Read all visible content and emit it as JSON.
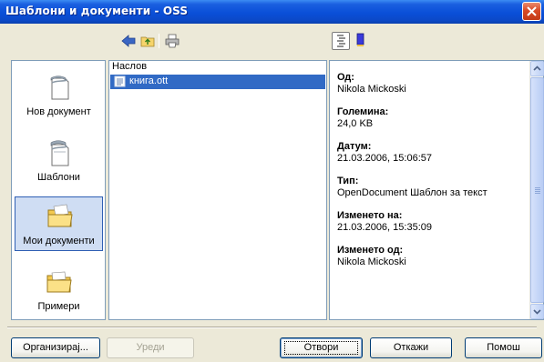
{
  "window": {
    "title": "Шаблони и документи - OSS"
  },
  "toolbar": {
    "back_icon": "back-arrow-icon",
    "up_icon": "folder-up-icon",
    "print_icon": "printer-icon",
    "preview_icon": "document-properties-icon",
    "preview_alt_icon": "document-preview-icon"
  },
  "sidebar": {
    "items": [
      {
        "label": "Нов документ",
        "icon": "new-document-icon",
        "selected": false
      },
      {
        "label": "Шаблони",
        "icon": "templates-icon",
        "selected": false
      },
      {
        "label": "Мои документи",
        "icon": "my-documents-folder-icon",
        "selected": true
      },
      {
        "label": "Примери",
        "icon": "examples-folder-icon",
        "selected": false
      }
    ]
  },
  "file_list": {
    "column_header": "Наслов",
    "files": [
      {
        "name": "книга.ott",
        "selected": true
      }
    ]
  },
  "properties": [
    {
      "key": "Од:",
      "value": "Nikola Mickoski"
    },
    {
      "key": "Големина:",
      "value": "24,0 KB"
    },
    {
      "key": "Датум:",
      "value": "21.03.2006, 15:06:57"
    },
    {
      "key": "Тип:",
      "value": "OpenDocument Шаблон за текст"
    },
    {
      "key": "Изменето на:",
      "value": "21.03.2006, 15:35:09"
    },
    {
      "key": "Изменето од:",
      "value": "Nikola Mickoski"
    }
  ],
  "buttons": {
    "organize": "Организирај...",
    "edit": "Уреди",
    "open": "Отвори",
    "cancel": "Откажи",
    "help": "Помош"
  },
  "colors": {
    "titlebar": "#0a4fd8",
    "selection": "#316ac5",
    "close": "#d84a26"
  }
}
